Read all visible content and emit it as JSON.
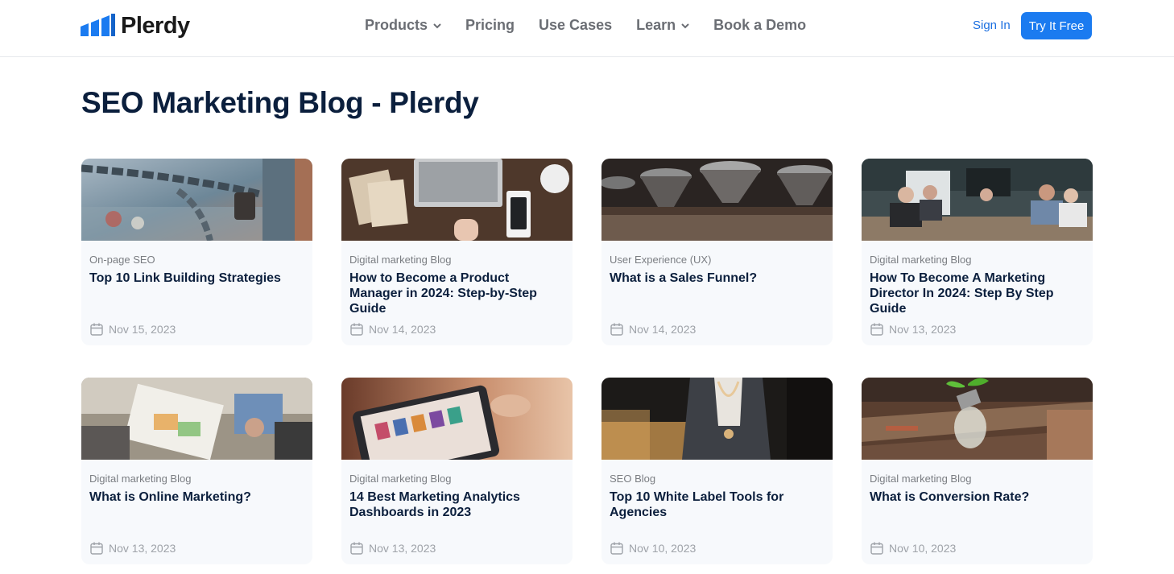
{
  "brand": {
    "name": "Plerdy"
  },
  "nav": {
    "items": [
      {
        "label": "Products",
        "dropdown": true
      },
      {
        "label": "Pricing",
        "dropdown": false
      },
      {
        "label": "Use Cases",
        "dropdown": false
      },
      {
        "label": "Learn",
        "dropdown": true
      },
      {
        "label": "Book a Demo",
        "dropdown": false
      }
    ],
    "signin": "Sign In",
    "cta": "Try It Free"
  },
  "page": {
    "title": "SEO Marketing Blog - Plerdy"
  },
  "colors": {
    "accent": "#1b7bf0",
    "link": "#1b6fe0",
    "heading": "#0b1f3d",
    "card_bg": "#f7f9fc"
  },
  "posts": [
    {
      "category": "On-page SEO",
      "title": "Top 10 Link Building Strategies",
      "date": "Nov 15, 2023",
      "image": "chain-padlock-photo"
    },
    {
      "category": "Digital marketing Blog",
      "title": "How to Become a Product Manager in 2024: Step-by-Step Guide",
      "date": "Nov 14, 2023",
      "image": "laptop-desk-photo"
    },
    {
      "category": "User Experience (UX)",
      "title": "What is a Sales Funnel?",
      "date": "Nov 14, 2023",
      "image": "glass-funnels-photo"
    },
    {
      "category": "Digital marketing Blog",
      "title": "How To Become A Marketing Director In 2024: Step By Step Guide",
      "date": "Nov 13, 2023",
      "image": "meeting-room-photo"
    },
    {
      "category": "Digital marketing Blog",
      "title": "What is Online Marketing?",
      "date": "Nov 13, 2023",
      "image": "team-papers-photo"
    },
    {
      "category": "Digital marketing Blog",
      "title": "14 Best Marketing Analytics Dashboards in 2023",
      "date": "Nov 13, 2023",
      "image": "tablet-dashboard-photo"
    },
    {
      "category": "SEO Blog",
      "title": "Top 10 White Label Tools for Agencies",
      "date": "Nov 10, 2023",
      "image": "person-necklace-photo"
    },
    {
      "category": "Digital marketing Blog",
      "title": "What is Conversion Rate?",
      "date": "Nov 10, 2023",
      "image": "lightbulb-plant-photo"
    }
  ]
}
